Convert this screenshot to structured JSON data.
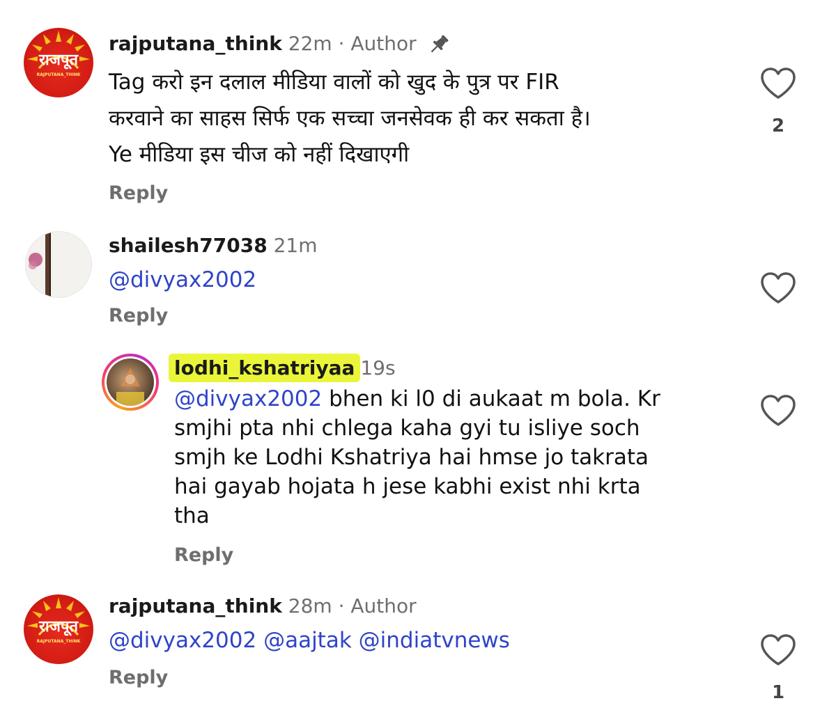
{
  "comments": [
    {
      "username": "rajputana_think",
      "time": "22m",
      "separator": "·",
      "badge": "Author",
      "pinned": true,
      "icon": "pin-icon",
      "lines": [
        "Tag करो इन दलाल मीडिया वालों को खुद के पुत्र पर FIR",
        "करवाने का साहस सिर्फ एक सच्चा जनसेवक ही कर सकता है।",
        "Ye मीडिया इस चीज को नहीं दिखाएगी"
      ],
      "reply_label": "Reply",
      "like_count": "2"
    },
    {
      "username": "shailesh77038",
      "time": "21m",
      "mention": "@divyax2002",
      "reply_label": "Reply"
    },
    {
      "username": "lodhi_kshatriyaa",
      "time": "19s",
      "highlight_color": "#eaf53a",
      "mention": "@divyax2002",
      "first_line_rest": " bhen ki l0 di aukaat m bola. Kr",
      "lines": [
        "smjhi pta nhi chlega kaha gyi tu isliye soch",
        "smjh ke Lodhi Kshatriya hai hmse jo takrata",
        "hai gayab hojata h jese kabhi exist nhi krta",
        "tha"
      ],
      "reply_label": "Reply"
    },
    {
      "username": "rajputana_think",
      "time": "28m",
      "separator": "·",
      "badge": "Author",
      "mentions": [
        "@divyax2002",
        "@aajtak",
        "@indiatvnews"
      ],
      "reply_label": "Reply",
      "like_count": "1"
    }
  ],
  "brand_avatar": {
    "title": "राजपूत",
    "subtitle": "RAJPUTANA_THINK"
  },
  "colors": {
    "mention": "#2f44c8",
    "secondary_text": "#6e6e6e",
    "highlight": "#eaf53a"
  }
}
